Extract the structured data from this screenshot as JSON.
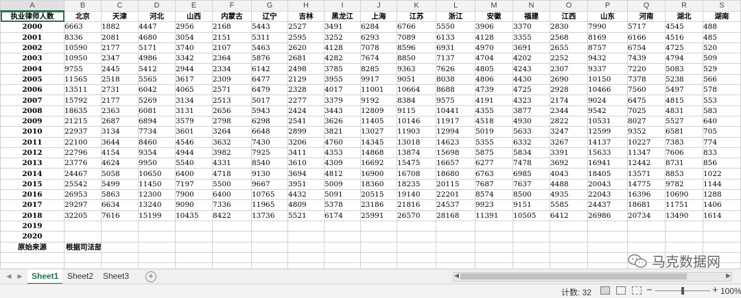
{
  "columns": [
    "A",
    "B",
    "C",
    "D",
    "E",
    "F",
    "G",
    "H",
    "I",
    "J",
    "K",
    "L",
    "M",
    "N",
    "O",
    "P",
    "Q",
    "R",
    "S"
  ],
  "header_row": {
    "label": "执业律师人数",
    "provinces": [
      "北京",
      "天津",
      "河北",
      "山西",
      "内蒙古",
      "辽宁",
      "吉林",
      "黑龙江",
      "上海",
      "江苏",
      "浙江",
      "安徽",
      "福建",
      "江西",
      "山东",
      "河南",
      "湖北",
      "湖南"
    ]
  },
  "rows": [
    {
      "year": "2000",
      "values": [
        "6663",
        "1882",
        "4447",
        "2956",
        "2168",
        "5443",
        "2527",
        "3491",
        "6284",
        "6766",
        "5550",
        "3906",
        "3370",
        "2830",
        "7990",
        "5717",
        "4545",
        "488"
      ]
    },
    {
      "year": "2001",
      "values": [
        "8336",
        "2081",
        "4680",
        "3054",
        "2151",
        "5311",
        "2595",
        "3252",
        "6293",
        "7089",
        "6133",
        "4128",
        "3355",
        "2568",
        "8169",
        "6166",
        "4516",
        "485"
      ]
    },
    {
      "year": "2002",
      "values": [
        "10590",
        "2177",
        "5171",
        "3740",
        "2107",
        "5463",
        "2620",
        "4128",
        "7078",
        "8596",
        "6931",
        "4970",
        "3691",
        "2655",
        "8757",
        "6754",
        "4725",
        "520"
      ]
    },
    {
      "year": "2003",
      "values": [
        "10950",
        "2347",
        "4986",
        "3342",
        "2364",
        "5876",
        "2681",
        "4282",
        "7674",
        "8850",
        "7137",
        "4704",
        "4202",
        "2252",
        "9432",
        "7439",
        "4794",
        "509"
      ]
    },
    {
      "year": "2004",
      "values": [
        "9755",
        "2445",
        "5412",
        "2944",
        "2334",
        "6142",
        "2498",
        "3785",
        "8285",
        "9363",
        "7626",
        "4805",
        "4243",
        "2307",
        "9337",
        "7220",
        "5083",
        "529"
      ]
    },
    {
      "year": "2005",
      "values": [
        "11565",
        "2518",
        "5565",
        "3617",
        "2309",
        "6477",
        "2129",
        "3955",
        "9917",
        "9051",
        "8038",
        "4806",
        "4430",
        "2690",
        "10150",
        "7378",
        "5238",
        "566"
      ]
    },
    {
      "year": "2006",
      "values": [
        "13511",
        "2731",
        "6042",
        "4065",
        "2571",
        "6479",
        "2328",
        "4017",
        "11001",
        "10664",
        "8688",
        "4739",
        "4725",
        "2928",
        "10466",
        "7560",
        "5497",
        "578"
      ]
    },
    {
      "year": "2007",
      "values": [
        "15792",
        "2177",
        "5269",
        "3134",
        "2513",
        "5017",
        "2277",
        "3379",
        "9192",
        "8384",
        "9575",
        "4191",
        "4323",
        "2174",
        "9024",
        "6475",
        "4815",
        "553"
      ]
    },
    {
      "year": "2008",
      "values": [
        "18635",
        "2363",
        "6081",
        "3131",
        "2656",
        "5943",
        "2424",
        "3443",
        "12809",
        "9115",
        "10441",
        "4355",
        "3877",
        "2344",
        "9542",
        "7025",
        "4831",
        "583"
      ]
    },
    {
      "year": "2009",
      "values": [
        "21215",
        "2687",
        "6894",
        "3579",
        "2798",
        "6298",
        "2541",
        "3626",
        "11405",
        "10146",
        "11917",
        "4518",
        "4930",
        "2822",
        "10531",
        "8027",
        "5527",
        "640"
      ]
    },
    {
      "year": "2010",
      "values": [
        "22937",
        "3134",
        "7734",
        "3601",
        "3264",
        "6648",
        "2899",
        "3821",
        "13027",
        "11903",
        "12994",
        "5019",
        "5633",
        "3247",
        "12599",
        "9352",
        "6581",
        "705"
      ]
    },
    {
      "year": "2011",
      "values": [
        "22100",
        "3644",
        "8460",
        "4546",
        "3632",
        "7430",
        "3206",
        "4760",
        "14345",
        "13018",
        "14623",
        "5355",
        "6332",
        "3267",
        "14137",
        "10227",
        "7383",
        "774"
      ]
    },
    {
      "year": "2012",
      "values": [
        "22796",
        "4154",
        "9354",
        "4944",
        "3982",
        "7925",
        "3411",
        "4353",
        "14868",
        "13874",
        "15698",
        "5875",
        "5834",
        "3391",
        "15633",
        "11347",
        "7606",
        "833"
      ]
    },
    {
      "year": "2013",
      "values": [
        "23776",
        "4624",
        "9950",
        "5540",
        "4331",
        "8540",
        "3610",
        "4309",
        "16692",
        "15475",
        "16657",
        "6277",
        "7478",
        "3692",
        "16941",
        "12442",
        "8731",
        "856"
      ]
    },
    {
      "year": "2014",
      "values": [
        "24467",
        "5058",
        "10650",
        "6400",
        "4718",
        "9130",
        "3694",
        "4812",
        "16900",
        "16708",
        "18680",
        "6763",
        "6985",
        "4043",
        "18405",
        "13571",
        "8853",
        "1022"
      ]
    },
    {
      "year": "2015",
      "values": [
        "25542",
        "5499",
        "11450",
        "7197",
        "5500",
        "9667",
        "3951",
        "5009",
        "18360",
        "18235",
        "20115",
        "7687",
        "7637",
        "4488",
        "20043",
        "14775",
        "9782",
        "1144"
      ]
    },
    {
      "year": "2016",
      "values": [
        "26953",
        "5863",
        "12300",
        "7900",
        "6400",
        "10765",
        "4432",
        "5091",
        "20515",
        "19140",
        "22201",
        "8574",
        "8500",
        "4935",
        "22043",
        "16396",
        "10690",
        "1288"
      ]
    },
    {
      "year": "2017",
      "values": [
        "29297",
        "6634",
        "13240",
        "9090",
        "7336",
        "11965",
        "4809",
        "5378",
        "23186",
        "21816",
        "24537",
        "9923",
        "9151",
        "5585",
        "24437",
        "18681",
        "11751",
        "1406"
      ]
    },
    {
      "year": "2018",
      "values": [
        "32205",
        "7616",
        "15199",
        "10435",
        "8422",
        "13736",
        "5521",
        "6174",
        "25991",
        "26570",
        "28168",
        "11391",
        "10505",
        "6412",
        "26986",
        "20734",
        "13490",
        "1614"
      ]
    },
    {
      "year": "2019",
      "values": [
        "",
        "",
        "",
        "",
        "",
        "",
        "",
        "",
        "",
        "",
        "",
        "",
        "",
        "",
        "",
        "",
        "",
        ""
      ]
    },
    {
      "year": "2020",
      "values": [
        "",
        "",
        "",
        "",
        "",
        "",
        "",
        "",
        "",
        "",
        "",
        "",
        "",
        "",
        "",
        "",
        "",
        ""
      ]
    }
  ],
  "source": {
    "label": "原始来源",
    "text": "根据司法部、各省司法厅、律师协会官方网站、《律师年鉴》及各省市统计年鉴综合整理"
  },
  "watermark": "马克数据网",
  "tabs": [
    "Sheet1",
    "Sheet2",
    "Sheet3"
  ],
  "active_tab": "Sheet1",
  "status": {
    "count": "计数: 32",
    "zoom": "100%"
  },
  "colors": {
    "accent": "#217346"
  }
}
